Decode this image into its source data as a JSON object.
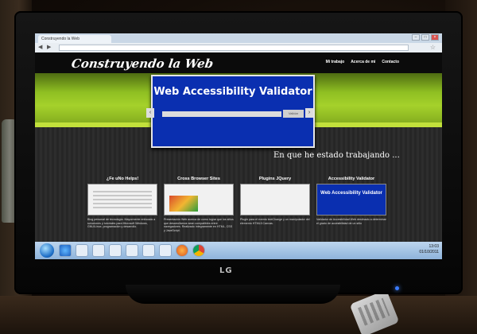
{
  "browser": {
    "tab_title": "Construyendo la Web",
    "url": "",
    "window_buttons": [
      "–",
      "□",
      "×"
    ]
  },
  "site": {
    "logo": "Construyendo la Web",
    "nav": [
      "Mi trabajo",
      "Acerca de mi",
      "Contacto"
    ],
    "feature": {
      "title": "Web Accessibility Validator",
      "button": "Validar",
      "prev": "‹",
      "next": "›"
    },
    "section_title": "En que he estado trabajando ...",
    "cards": [
      {
        "title": "¿Fe uNo Helps!",
        "desc": "Blog personal de tecnología. Mayormente enfocado a soluciones y tutoriales para Microsoft Windows, GNU/Linux, programación y desarrollo."
      },
      {
        "title": "Cross Browser Sites",
        "desc": "Presentación Web acerca de como lograr que los sitios que desarrollamos sean compatibles entre navegadores. Realizado íntegramente en HTML, CSS y JavaScript."
      },
      {
        "title": "Plugins JQuery",
        "desc": "Plugin para el evento textChange y un manipulador del elemento HTML5 Canvas."
      },
      {
        "title": "Accessibility Validator",
        "thumb_text": "Web Accessibility Validator",
        "desc": "Validador de Accesibilidad Web destinado a determinar el grado de accesibilidad de un sitio"
      }
    ]
  },
  "taskbar": {
    "time": "13:03",
    "date": "01/10/2011"
  },
  "tv": {
    "brand": "LG"
  },
  "colors": {
    "accent_green": "#a5d12b",
    "feature_blue": "#0a2fb0",
    "header_black": "#0b0b0b"
  },
  "icons": [
    "start-orb-icon",
    "ie-icon",
    "chrome-icon",
    "firefox-icon",
    "star-icon",
    "back-arrow-icon",
    "forward-arrow-icon"
  ]
}
